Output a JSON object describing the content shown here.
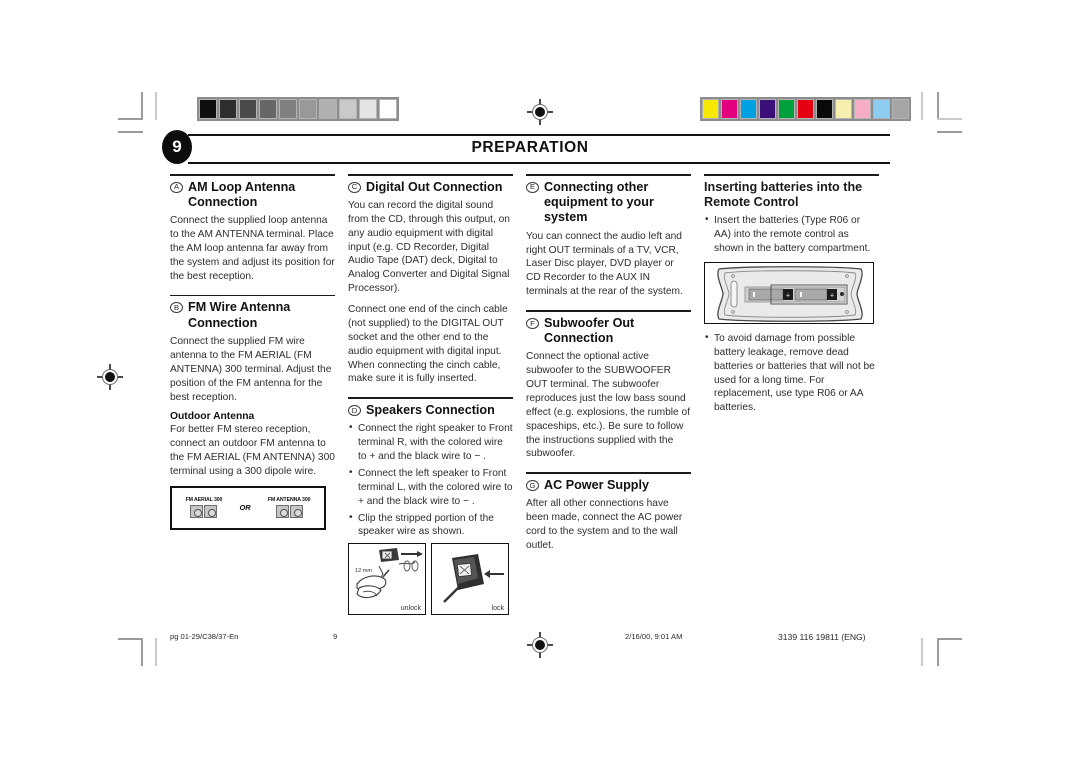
{
  "header": {
    "page_badge": "9",
    "title": "PREPARATION"
  },
  "columns": [
    {
      "id": "column-1",
      "sections": [
        {
          "letter": "A",
          "title": "AM Loop Antenna Connection",
          "paragraphs": [
            "Connect the supplied loop antenna to the AM ANTENNA terminal. Place the AM loop antenna far away from the system and adjust its position for the best reception."
          ]
        },
        {
          "letter": "B",
          "title": "FM Wire Antenna Connection",
          "paragraphs": [
            "Connect the supplied FM wire antenna to the FM AERIAL (FM ANTENNA) 300    terminal. Adjust the position of the FM antenna for the best reception."
          ],
          "sub_head": "Outdoor Antenna",
          "sub_paragraphs": [
            "For better FM stereo reception, connect an outdoor FM antenna to the FM AERIAL (FM ANTENNA) 300 terminal using a 300    dipole wire."
          ],
          "figure": {
            "name": "fm-aerial-terminals",
            "left_label": "FM AERIAL 300",
            "or_text": "OR",
            "right_label": "FM ANTENNA 300"
          }
        }
      ]
    },
    {
      "id": "column-2",
      "sections": [
        {
          "letter": "C",
          "title": "Digital Out Connection",
          "paragraphs": [
            "You can record the digital sound from the CD, through this output, on any audio equipment with digital input (e.g. CD Recorder, Digital Audio Tape (DAT) deck, Digital to Analog Converter and Digital Signal Processor).",
            "Connect one end of the cinch cable (not supplied) to the DIGITAL OUT socket and the other end to the audio equipment with digital input. When connecting the cinch cable, make sure it is fully inserted."
          ]
        },
        {
          "letter": "D",
          "title": "Speakers Connection",
          "bullets": [
            "Connect the right speaker to Front terminal R, with the colored wire to + and the black wire to − .",
            "Connect the left speaker to Front terminal L, with the colored wire to + and the black wire to − .",
            "Clip the stripped portion of the speaker wire as shown."
          ],
          "figures": {
            "name": "speaker-clip-figures",
            "measurement": "12 mm",
            "left_caption": "unlock",
            "right_caption": "lock"
          }
        }
      ]
    },
    {
      "id": "column-3",
      "sections": [
        {
          "letter": "E",
          "title": "Connecting other equipment to your system",
          "paragraphs": [
            "You can connect the audio left and right OUT terminals of a TV, VCR, Laser Disc player, DVD player or CD Recorder to the AUX IN terminals at the rear of the system."
          ]
        },
        {
          "letter": "F",
          "title": "Subwoofer Out Connection",
          "paragraphs": [
            "Connect the optional active subwoofer to the SUBWOOFER OUT terminal. The subwoofer reproduces just the low bass sound effect (e.g. explosions, the rumble of spaceships, etc.). Be sure to follow the instructions supplied with the subwoofer."
          ]
        },
        {
          "letter": "G",
          "title": "AC Power Supply",
          "paragraphs": [
            "After all other connections have been made, connect the AC power cord to the system and to the wall outlet."
          ]
        }
      ]
    },
    {
      "id": "column-4",
      "sections": [
        {
          "letter": "",
          "title": "Inserting batteries into the Remote Control",
          "bullets": [
            "Insert the batteries (Type R06 or AA) into the remote control as shown in the battery compartment."
          ],
          "figure": {
            "name": "remote-battery-compartment"
          },
          "bullets_after": [
            "To avoid damage from possible battery leakage, remove dead batteries or batteries that will not be used for a long time. For replacement, use type R06 or AA batteries."
          ]
        }
      ]
    }
  ],
  "footer": {
    "file": "pg 01-29/C38/37-En",
    "page_number": "9",
    "timestamp": "2/16/00, 9:01 AM",
    "doc_code": "3139 116 19811 (ENG)"
  },
  "calibration": {
    "grayscale": [
      "#0f0f0f",
      "#2e2e2e",
      "#4a4a4a",
      "#666666",
      "#808080",
      "#999999",
      "#b0b0b0",
      "#c9c9c9",
      "#e4e4e4",
      "#ffffff"
    ],
    "colors": [
      "#f6e800",
      "#e3007f",
      "#00a0e3",
      "#3b0f7a",
      "#00a03c",
      "#e50012",
      "#0a0a0a",
      "#f7efb0",
      "#f5aec6",
      "#8ecdf0",
      "#a5a5a5"
    ]
  }
}
